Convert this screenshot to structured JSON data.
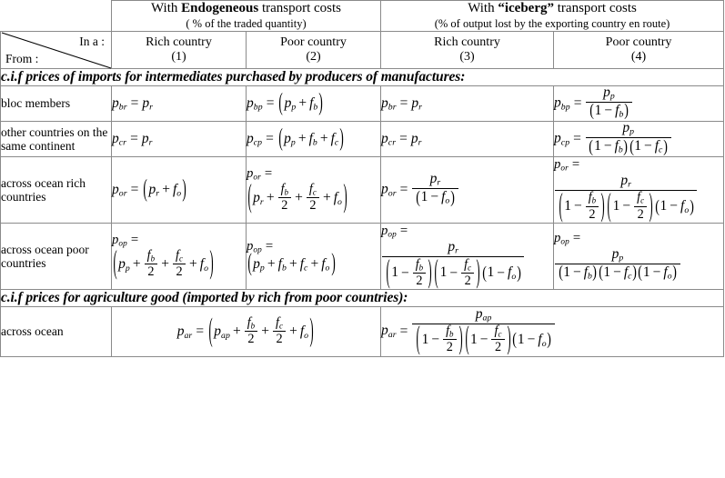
{
  "table": {
    "corner": {
      "in_a": "In a :",
      "from": "From :"
    },
    "group_headers": [
      {
        "line1_pre": "With ",
        "line1_bold": "Endogeneous",
        "line1_post": " transport costs",
        "line2": "( % of the traded quantity)"
      },
      {
        "line1_pre": "With ",
        "line1_bold": "“iceberg”",
        "line1_post": " transport costs",
        "line2": "(% of output lost by the exporting country en route)"
      }
    ],
    "column_headers": [
      {
        "name": "Rich country",
        "number": "(1)"
      },
      {
        "name": "Poor country",
        "number": "(2)"
      },
      {
        "name": "Rich country",
        "number": "(3)"
      },
      {
        "name": "Poor country",
        "number": "(4)"
      }
    ],
    "sections": [
      {
        "title": "c.i.f prices of imports for intermediates purchased by producers of manufactures:",
        "rows": [
          {
            "label": "bloc members",
            "cells": [
              {
                "lhs": "p",
                "lhs_sub": "br",
                "rhs": "p_r"
              },
              {
                "lhs": "p",
                "lhs_sub": "bp",
                "rhs": "( p_p + f_b )"
              },
              {
                "lhs": "p",
                "lhs_sub": "br",
                "rhs": "p_r"
              },
              {
                "lhs": "p",
                "lhs_sub": "bp",
                "rhs": "p_p / (1 - f_b)"
              }
            ]
          },
          {
            "label": "other countries on the same continent",
            "cells": [
              {
                "lhs": "p",
                "lhs_sub": "cr",
                "rhs": "p_r"
              },
              {
                "lhs": "p",
                "lhs_sub": "cp",
                "rhs": "( p_p + f_b + f_c )"
              },
              {
                "lhs": "p",
                "lhs_sub": "cr",
                "rhs": "p_r"
              },
              {
                "lhs": "p",
                "lhs_sub": "cp",
                "rhs": "p_p / (1 - f_b)(1 - f_c)"
              }
            ]
          },
          {
            "label": "across ocean rich countries",
            "cells": [
              {
                "lhs": "p",
                "lhs_sub": "or",
                "rhs": "( p_r + f_o )"
              },
              {
                "lhs": "p",
                "lhs_sub": "or",
                "rhs": "( p_r + f_b/2 + f_c/2 + f_o )"
              },
              {
                "lhs": "p",
                "lhs_sub": "or",
                "rhs": "p_r / (1 - f_o)"
              },
              {
                "lhs": "p",
                "lhs_sub": "or",
                "rhs": "p_r / (1 - f_b/2)(1 - f_c/2)(1 - f_o)"
              }
            ]
          },
          {
            "label": "across ocean poor countries",
            "cells": [
              {
                "lhs": "p",
                "lhs_sub": "op",
                "rhs": "( p_p + f_b/2 + f_c/2 + f_o )"
              },
              {
                "lhs": "p",
                "lhs_sub": "op",
                "rhs": "( p_p + f_b + f_c + f_o )"
              },
              {
                "lhs": "p",
                "lhs_sub": "op",
                "rhs": "p_r / (1 - f_b/2)(1 - f_c/2)(1 - f_o)"
              },
              {
                "lhs": "p",
                "lhs_sub": "op",
                "rhs": "p_p / (1 - f_b)(1 - f_c)(1 - f_o)"
              }
            ]
          }
        ]
      },
      {
        "title": "c.i.f prices for agriculture good (imported by rich from poor countries):",
        "rows": [
          {
            "label": "across ocean",
            "cells": [
              {
                "lhs": "p",
                "lhs_sub": "ar",
                "rhs": "( p_ap + f_b/2 + f_c/2 + f_o )"
              },
              {
                "lhs": "p",
                "lhs_sub": "ar",
                "rhs": "p_ap / (1 - f_b/2)(1 - f_c/2)(1 - f_o)"
              }
            ]
          }
        ]
      }
    ],
    "symbols": {
      "p": "p",
      "one": "1",
      "two": "2",
      "plus": "+",
      "minus": "−",
      "equals": "=",
      "sub_b": "b",
      "sub_c": "c",
      "sub_o": "o",
      "sub_r": "r",
      "sub_p": "p",
      "sub_br": "br",
      "sub_bp": "bp",
      "sub_cr": "cr",
      "sub_cp": "cp",
      "sub_or": "or",
      "sub_op": "op",
      "sub_ar": "ar",
      "sub_ap": "ap",
      "f": "f"
    },
    "colors": {
      "border": "#8a8a8a",
      "text": "#000000",
      "background": "#ffffff"
    }
  }
}
